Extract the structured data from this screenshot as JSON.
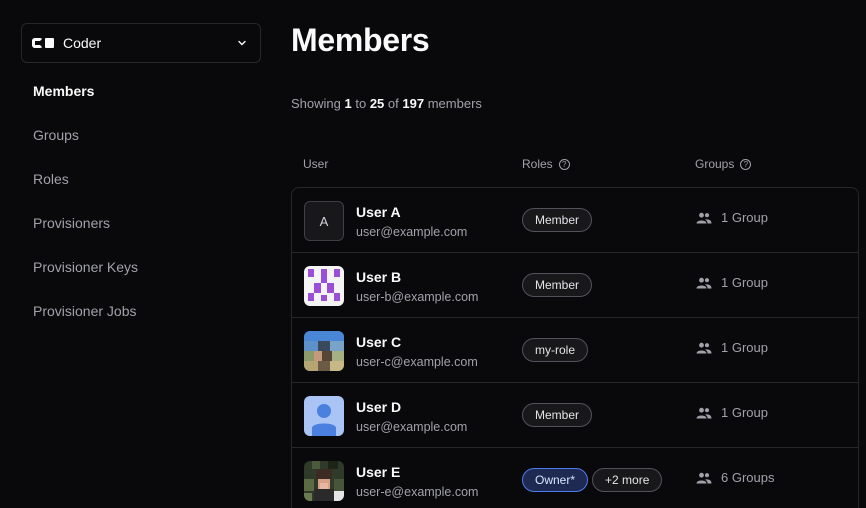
{
  "org": {
    "name": "Coder"
  },
  "nav": [
    "Members",
    "Groups",
    "Roles",
    "Provisioners",
    "Provisioner Keys",
    "Provisioner Jobs"
  ],
  "page": {
    "title": "Members",
    "showing_prefix": "Showing",
    "range_start": "1",
    "to": "to",
    "range_end": "25",
    "of": "of",
    "total": "197",
    "members_word": "members"
  },
  "columns": {
    "user": "User",
    "roles": "Roles",
    "groups": "Groups"
  },
  "users": [
    {
      "name": "User A",
      "email": "user@example.com",
      "avatar_letter": "A",
      "roles": [
        "Member"
      ],
      "groups": "1 Group"
    },
    {
      "name": "User B",
      "email": "user-b@example.com",
      "roles": [
        "Member"
      ],
      "groups": "1 Group"
    },
    {
      "name": "User C",
      "email": "user-c@example.com",
      "roles": [
        "my-role"
      ],
      "groups": "1 Group"
    },
    {
      "name": "User D",
      "email": "user@example.com",
      "roles": [
        "Member"
      ],
      "groups": "1 Group"
    },
    {
      "name": "User E",
      "email": "user-e@example.com",
      "roles": [
        "Owner*",
        "+2 more"
      ],
      "groups": "6 Groups"
    }
  ],
  "colors": {
    "background": "#09090b",
    "border": "#27272a",
    "owner_accent": "#4f7bf0",
    "avatar_b": "#9b4fd9",
    "avatar_d": "#4b7fe0"
  }
}
